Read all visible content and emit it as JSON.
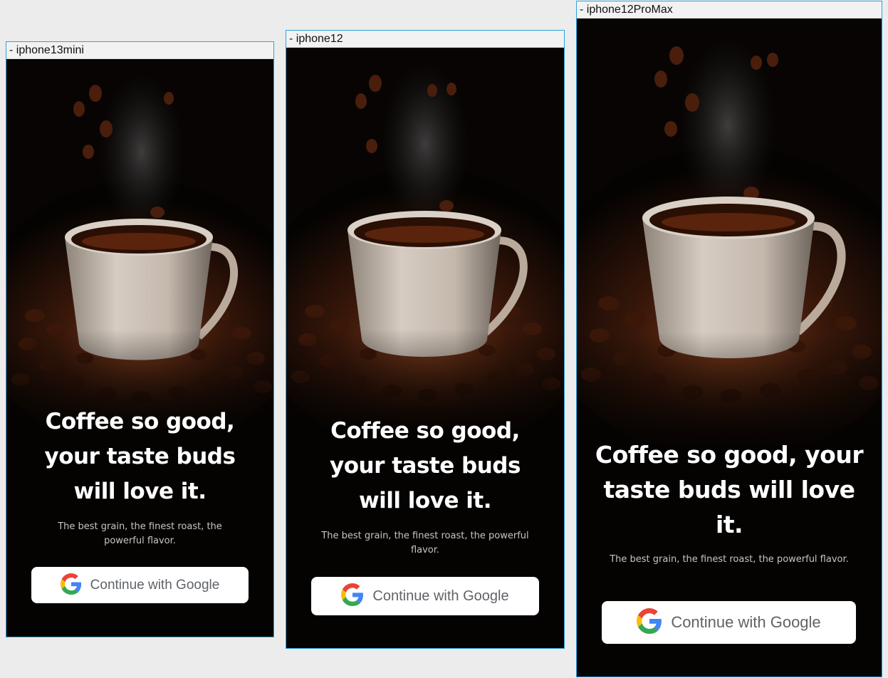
{
  "artboards": [
    {
      "label": "- iphone13mini",
      "headline": "Coffee so good, your taste buds will love it.",
      "subtitle": "The best grain, the finest roast, the powerful flavor.",
      "button_label": "Continue with Google"
    },
    {
      "label": "- iphone12",
      "headline": "Coffee so good, your taste buds will love it.",
      "subtitle": "The best grain, the finest roast, the powerful flavor.",
      "button_label": "Continue with Google"
    },
    {
      "label": "- iphone12ProMax",
      "headline": "Coffee so good, your taste buds will love it.",
      "subtitle": "The best grain, the finest roast, the powerful flavor.",
      "button_label": "Continue with Google"
    }
  ],
  "icons": {
    "hero_image": "coffee-cup-with-beans-image",
    "button_icon": "google-logo-icon"
  },
  "colors": {
    "screen_background": "#050302",
    "headline": "#ffffff",
    "subtitle": "#c9c4c0",
    "button_background": "#ffffff",
    "button_text": "#5f6368",
    "frame_border": "#2aa4e0",
    "canvas_background": "#ececec"
  }
}
